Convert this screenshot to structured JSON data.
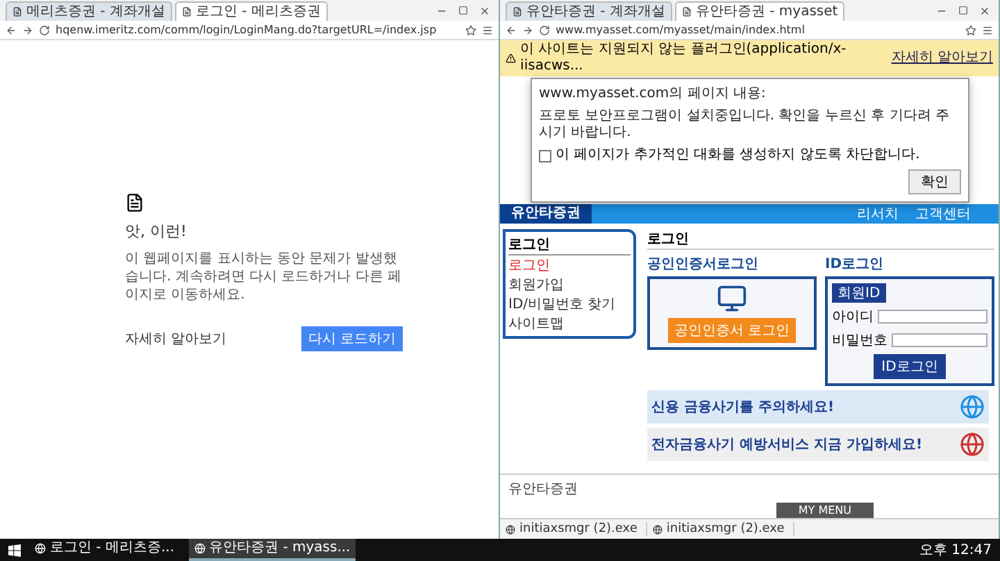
{
  "left_window": {
    "tabs": [
      {
        "label": "메리츠증권 - 계좌개설",
        "selected": false
      },
      {
        "label": "로그인 - 메리츠증권",
        "selected": true
      }
    ],
    "url": "hqenw.imeritz.com/comm/login/LoginMang.do?targetURL=/index.jsp",
    "error": {
      "title": "앗, 이런!",
      "message": "이 웹페이지를 표시하는 동안 문제가 발생했습니다. 계속하려면 다시 로드하거나 다른 페이지로 이동하세요.",
      "link": "자세히 알아보기",
      "button": "다시 로드하기"
    }
  },
  "right_window": {
    "tabs": [
      {
        "label": "유안타증권 - 계좌개설",
        "selected": false
      },
      {
        "label": "유안타증권 - myasset",
        "selected": true
      }
    ],
    "url": "www.myasset.com/myasset/main/index.html",
    "infobar": {
      "message": "이 사이트는 지원되지 않는 플러그인(application/x-iisacws...",
      "link": "자세히 알아보기"
    },
    "dialog": {
      "title": "www.myasset.com의 페이지 내용:",
      "message": "프로토 보안프로그램이 설치중입니다. 확인을 누르신 후 기다려 주시기 바랍니다.",
      "checkbox": {
        "label": "이 페이지가 추가적인 대화를 생성하지 않도록 차단합니다.",
        "checked": false
      },
      "button": "확인"
    },
    "site": {
      "logo": "유안타증권",
      "nav": [
        "리서치",
        "고객센터"
      ],
      "sidebar": {
        "title": "로그인",
        "items": [
          {
            "label": "로그인",
            "selected": true
          },
          {
            "label": "회원가입",
            "selected": false
          },
          {
            "label": "ID/비밀번호 찾기",
            "selected": false
          },
          {
            "label": "사이트맵",
            "selected": false
          }
        ]
      },
      "page_title": "로그인",
      "cert_login": {
        "title": "공인인증서로그인",
        "button": "공인인증서 로그인"
      },
      "id_login": {
        "title": "ID로그인",
        "tab": "회원ID",
        "fields": [
          {
            "label": "아이디"
          },
          {
            "label": "비밀번호"
          }
        ],
        "button": "ID로그인"
      },
      "banners": [
        {
          "title": "신용 금융사기를 주의하세요!"
        },
        {
          "title": "전자금융사기 예방서비스 지금 가입하세요!"
        }
      ],
      "footer": "유안타증권"
    },
    "bottom_bar": {
      "label": "MY MENU"
    },
    "downloads": [
      "initiaxsmgr (2).exe",
      "initiaxsmgr (2).exe"
    ]
  },
  "taskbar": {
    "items": [
      {
        "label": "로그인 - 메리츠증...",
        "selected": false
      },
      {
        "label": "유안타증권 - myass...",
        "selected": true
      }
    ],
    "clock": "오후 12:47"
  }
}
